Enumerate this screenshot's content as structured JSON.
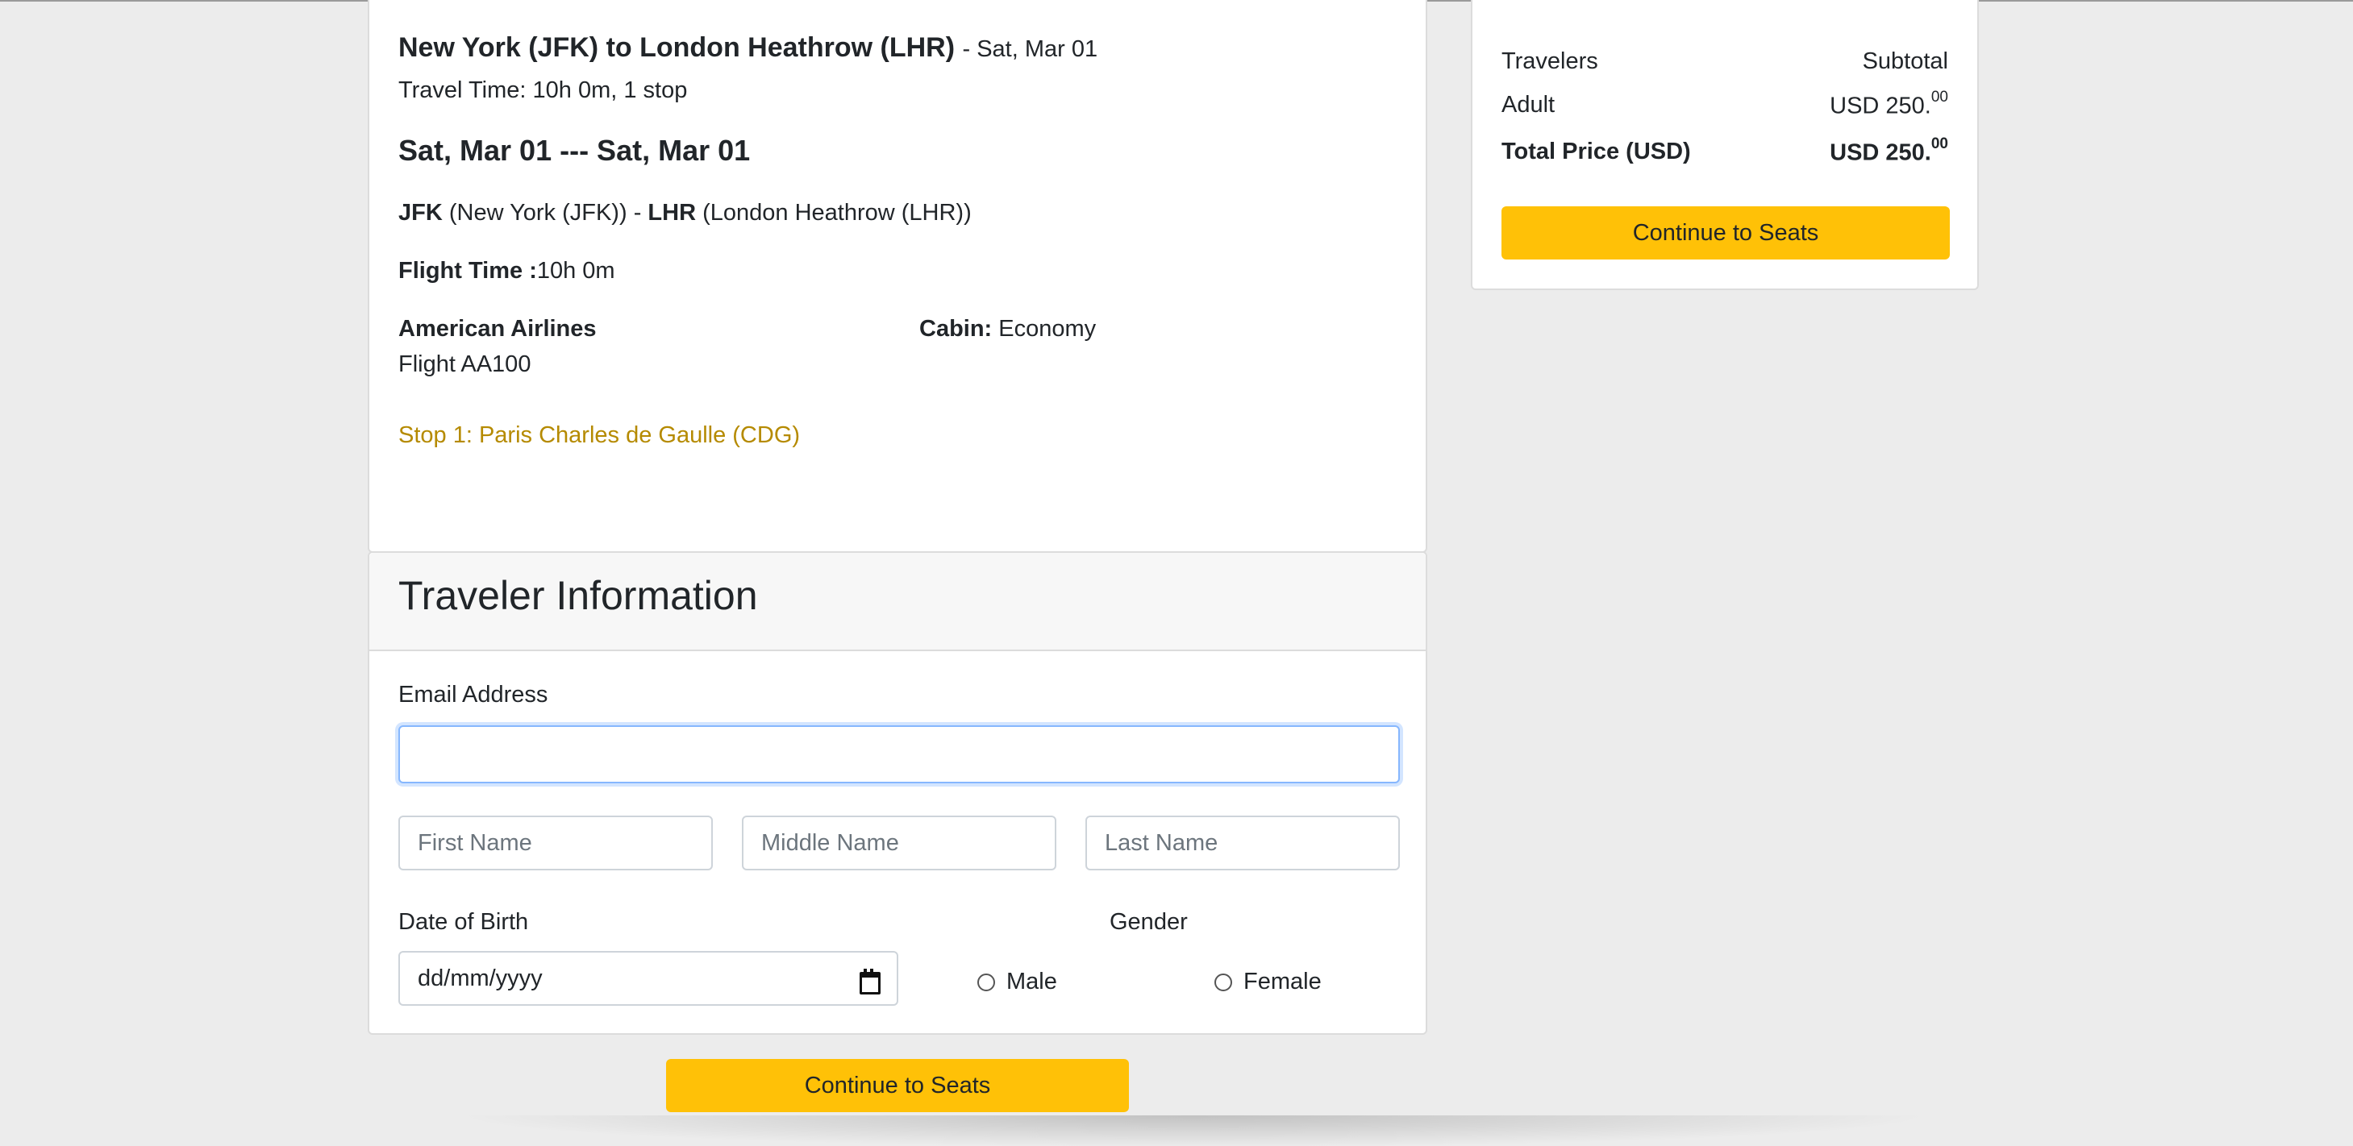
{
  "flight": {
    "route": "New York (JFK) to London Heathrow (LHR)",
    "route_date": "- Sat, Mar 01",
    "travel_time": "Travel Time: 10h 0m, 1 stop",
    "date_range": "Sat, Mar 01 --- Sat, Mar 01",
    "origin_code": "JFK",
    "origin_name": "(New York (JFK))",
    "separator": "-",
    "dest_code": "LHR",
    "dest_name": "(London Heathrow (LHR))",
    "flight_time_label": "Flight Time :",
    "flight_time_value": "10h 0m",
    "airline": "American Airlines",
    "flight_number": "Flight AA100",
    "cabin_label": "Cabin:",
    "cabin_value": "Economy",
    "stop": "Stop 1: Paris Charles de Gaulle (CDG)"
  },
  "traveler": {
    "title": "Traveler Information",
    "email_label": "Email Address",
    "email_value": "",
    "first_name_placeholder": "First Name",
    "middle_name_placeholder": "Middle Name",
    "last_name_placeholder": "Last Name",
    "dob_label": "Date of Birth",
    "dob_placeholder": "dd/mm/yyyy",
    "gender_label": "Gender",
    "gender_options": [
      "Male",
      "Female"
    ]
  },
  "price": {
    "travelers_label": "Travelers",
    "subtotal_label": "Subtotal",
    "adult_label": "Adult",
    "adult_price_main": "USD 250.",
    "adult_price_cents": "00",
    "total_label": "Total Price (USD)",
    "total_price_main": "USD 250.",
    "total_price_cents": "00",
    "continue_label": "Continue to Seats"
  },
  "bottom": {
    "continue_label": "Continue to Seats"
  },
  "colors": {
    "accent": "#ffc107",
    "stop_text": "#b58a00",
    "focus_border": "#86b7fe"
  }
}
